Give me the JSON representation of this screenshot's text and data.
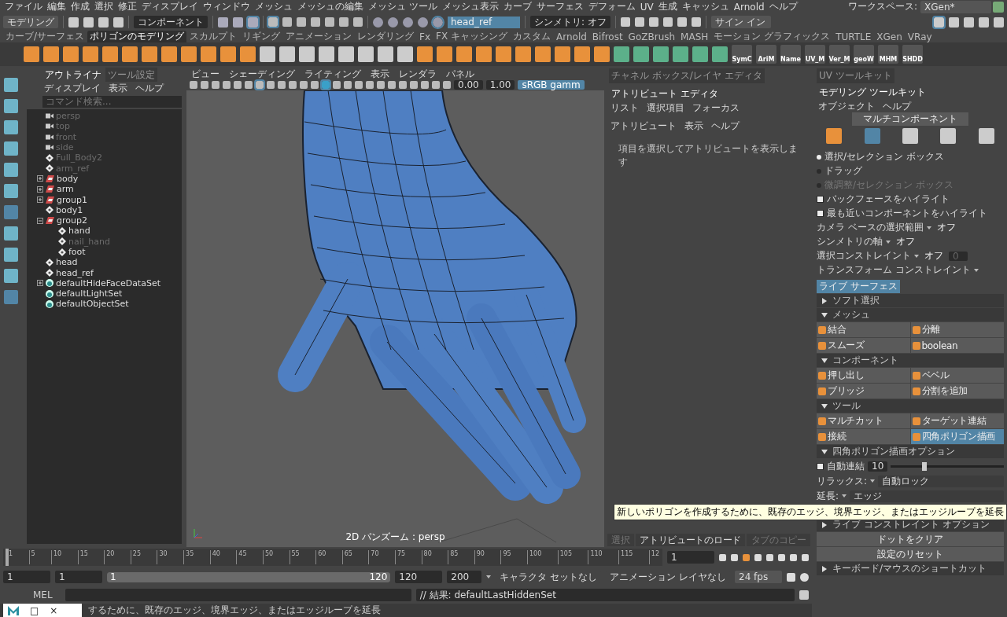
{
  "menubar": {
    "items": [
      "ファイル",
      "編集",
      "作成",
      "選択",
      "修正",
      "ディスプレイ",
      "ウィンドウ",
      "メッシュ",
      "メッシュの編集",
      "メッシュ ツール",
      "メッシュ表示",
      "カーブ",
      "サーフェス",
      "デフォーム",
      "UV",
      "生成",
      "キャッシュ",
      "Arnold",
      "ヘルプ"
    ],
    "workspace_label": "ワークスペース:",
    "workspace_value": "XGen*"
  },
  "status_line": {
    "mode": "モデリング",
    "component": "コンポーネント",
    "object_field": "head_ref",
    "symmetry": "シンメトリ: オフ",
    "sign_in": "サイン イン"
  },
  "shelf": {
    "tabs": [
      {
        "label": "カーブ/サーフェス",
        "selected": false
      },
      {
        "label": "ポリゴンのモデリング",
        "selected": true
      },
      {
        "label": "スカルプト",
        "selected": false
      },
      {
        "label": "リギング",
        "selected": false
      },
      {
        "label": "アニメーション",
        "selected": false
      },
      {
        "label": "レンダリング",
        "selected": false
      },
      {
        "label": "Fx",
        "selected": false
      },
      {
        "label": "FX キャッシング",
        "selected": false
      },
      {
        "label": "カスタム",
        "selected": false
      },
      {
        "label": "Arnold",
        "selected": false
      },
      {
        "label": "Bifrost",
        "selected": false
      },
      {
        "label": "GoZBrush",
        "selected": false
      },
      {
        "label": "MASH",
        "selected": false
      },
      {
        "label": "モーション グラフィックス",
        "selected": false
      },
      {
        "label": "TURTLE",
        "selected": false
      },
      {
        "label": "XGen",
        "selected": false
      },
      {
        "label": "VRay",
        "selected": false
      }
    ],
    "labeled_tools": [
      "SymC",
      "AriM",
      "Name",
      "UV_M",
      "Ver_M",
      "geoW",
      "MHM",
      "SHDD"
    ]
  },
  "outliner": {
    "tabs": [
      {
        "label": "アウトライナ",
        "selected": true
      },
      {
        "label": "ツール設定",
        "selected": false
      }
    ],
    "menu": [
      "ディスプレイ",
      "表示",
      "ヘルプ"
    ],
    "search_placeholder": "コマンド検索...",
    "items": [
      {
        "name": "persp",
        "kind": "camera",
        "dimmed": true
      },
      {
        "name": "top",
        "kind": "camera",
        "dimmed": true
      },
      {
        "name": "front",
        "kind": "camera",
        "dimmed": true
      },
      {
        "name": "side",
        "kind": "camera",
        "dimmed": true
      },
      {
        "name": "Full_Body2",
        "kind": "transform",
        "dimmed": true
      },
      {
        "name": "arm_ref",
        "kind": "transform",
        "dimmed": true
      },
      {
        "name": "body",
        "kind": "group",
        "dimmed": false,
        "expanded": false
      },
      {
        "name": "arm",
        "kind": "group",
        "dimmed": false,
        "expanded": false
      },
      {
        "name": "group1",
        "kind": "group",
        "dimmed": false,
        "expanded": false
      },
      {
        "name": "body1",
        "kind": "transform",
        "dimmed": false
      },
      {
        "name": "group2",
        "kind": "group",
        "dimmed": false,
        "expanded": true,
        "children": [
          {
            "name": "hand",
            "kind": "transform",
            "dimmed": false
          },
          {
            "name": "nail_hand",
            "kind": "transform",
            "dimmed": true
          },
          {
            "name": "foot",
            "kind": "transform",
            "dimmed": false
          }
        ]
      },
      {
        "name": "head",
        "kind": "transform",
        "dimmed": false
      },
      {
        "name": "head_ref",
        "kind": "transform",
        "dimmed": false
      },
      {
        "name": "defaultHideFaceDataSet",
        "kind": "set",
        "dimmed": false,
        "expanded": false
      },
      {
        "name": "defaultLightSet",
        "kind": "set",
        "dimmed": false
      },
      {
        "name": "defaultObjectSet",
        "kind": "set",
        "dimmed": false
      }
    ]
  },
  "viewport": {
    "menu": [
      "ビュー",
      "シェーディング",
      "ライティング",
      "表示",
      "レンダラ",
      "パネル"
    ],
    "exposure": "0.00",
    "gamma": "1.00",
    "color_space": "sRGB gamm",
    "camera_label": "2D パンズーム : persp"
  },
  "attribute_editor": {
    "tabs": [
      {
        "label": "チャネル ボックス/レイヤ エディタ",
        "selected": false
      },
      {
        "label": "アトリビュート エディタ",
        "selected": true
      }
    ],
    "menu": [
      "リスト",
      "選択項目",
      "フォーカス",
      "アトリビュート",
      "表示",
      "ヘルプ"
    ],
    "message": "項目を選択してアトリビュートを表示します",
    "buttons": [
      {
        "label": "選択",
        "disabled": true
      },
      {
        "label": "アトリビュートのロード",
        "disabled": false
      },
      {
        "label": "タブのコピー",
        "disabled": true
      }
    ]
  },
  "toolkit": {
    "tabs": [
      {
        "label": "UV ツールキット",
        "selected": false
      },
      {
        "label": "モデリング ツールキット",
        "selected": true
      }
    ],
    "menu": [
      "オブジェクト",
      "ヘルプ"
    ],
    "mode_button": "マルチコンポーネント",
    "component_modes": [
      {
        "selected": false
      },
      {
        "selected": true
      },
      {
        "selected": false
      },
      {
        "selected": false
      },
      {
        "selected": false
      }
    ],
    "radios": [
      {
        "label": "選択/セレクション ボックス",
        "selected": true,
        "disabled": false
      },
      {
        "label": "ドラッグ",
        "selected": false,
        "disabled": false
      },
      {
        "label": "微調整/セレクション ボックス",
        "selected": false,
        "disabled": true
      }
    ],
    "checkboxes": [
      {
        "label": "バックフェースをハイライト",
        "checked": true
      },
      {
        "label": "最も近いコンポーネントをハイライト",
        "checked": true
      }
    ],
    "dropdowns": [
      {
        "label": "カメラ ベースの選択範囲",
        "value": "オフ",
        "highlighted": false
      },
      {
        "label": "シンメトリの軸",
        "value": "オフ",
        "highlighted": false
      },
      {
        "label": "選択コンストレイント",
        "value": "オフ",
        "highlighted": false,
        "field": "0"
      },
      {
        "label": "トランスフォーム コンストレイント",
        "value": "ライブ サーフェス",
        "highlighted": true
      }
    ],
    "items": [
      {
        "kind": "section",
        "title": "ソフト選択",
        "expanded": false
      },
      {
        "kind": "section",
        "title": "メッシュ",
        "expanded": true,
        "buttons": [
          {
            "label": "結合",
            "selected": false
          },
          {
            "label": "分離",
            "selected": false
          },
          {
            "label": "スムーズ",
            "selected": false
          },
          {
            "label": "boolean",
            "selected": false
          }
        ]
      },
      {
        "kind": "section",
        "title": "コンポーネント",
        "expanded": true,
        "buttons": [
          {
            "label": "押し出し",
            "selected": false
          },
          {
            "label": "ベベル",
            "selected": false
          },
          {
            "label": "ブリッジ",
            "selected": false
          },
          {
            "label": "分割を追加",
            "selected": false
          }
        ]
      },
      {
        "kind": "section",
        "title": "ツール",
        "expanded": true,
        "buttons": [
          {
            "label": "マルチカット",
            "selected": false
          },
          {
            "label": "ターゲット連結",
            "selected": false
          },
          {
            "label": "接続",
            "selected": false
          },
          {
            "label": "四角ポリゴン描画",
            "selected": true
          }
        ]
      },
      {
        "kind": "section",
        "title": "四角ポリゴン描画オプション",
        "expanded": true,
        "auto_weld": {
          "label": "自動連結",
          "checked": true,
          "value": "10",
          "level": 0.3
        },
        "fields": [
          {
            "label": "リラックス:",
            "value": "自動ロック"
          },
          {
            "label": "延長:",
            "value": "エッジ"
          }
        ]
      },
      {
        "kind": "section",
        "title": "ライブ コンストレイント オプション",
        "expanded": false
      },
      {
        "kind": "action",
        "label": "ドットをクリア"
      },
      {
        "kind": "action",
        "label": "設定のリセット"
      },
      {
        "kind": "section",
        "title": "キーボード/マウスのショートカット",
        "expanded": false
      }
    ],
    "tooltip": "新しいポリゴンを作成するために、既存のエッジ、境界エッジ、またはエッジループを延長"
  },
  "timeline": {
    "ticks": [
      "1",
      "5",
      "10",
      "15",
      "20",
      "25",
      "30",
      "35",
      "40",
      "45",
      "50",
      "55",
      "60",
      "65",
      "70",
      "75",
      "80",
      "85",
      "90",
      "95",
      "100",
      "105",
      "110",
      "115",
      "12"
    ],
    "current_frame": "1",
    "level": 0
  },
  "range": {
    "start": "1",
    "playback_start": "1",
    "slider_start": "1",
    "slider_end": "120",
    "playback_end": "120",
    "end": "200",
    "level": 1,
    "character_set": "キャラクタ セットなし",
    "anim_layer": "アニメーション レイヤなし",
    "fps": "24 fps"
  },
  "command_line": {
    "language": "MEL",
    "result": "// 結果: defaultLastHiddenSet"
  },
  "help_line": "するために、既存のエッジ、境界エッジ、またはエッジループを延長",
  "taskbar_preview": {
    "controls": [
      "□",
      "×"
    ]
  }
}
